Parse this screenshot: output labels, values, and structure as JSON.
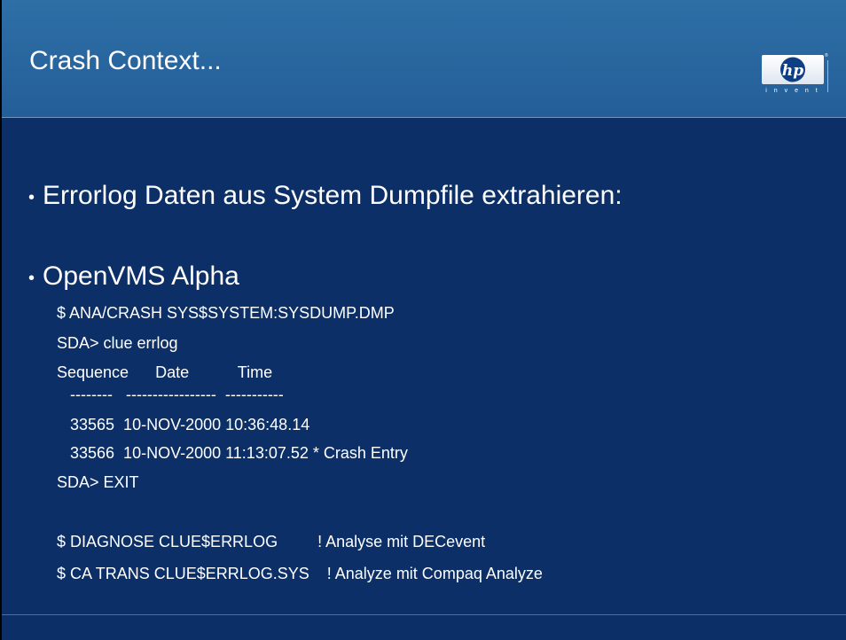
{
  "slide": {
    "title": "Crash Context...",
    "logo": {
      "mark_text": "hp",
      "tagline": "i n v e n t",
      "icon": "hp-logo-icon"
    },
    "bullets": [
      {
        "text": "Errorlog Daten aus System Dumpfile extrahieren:"
      },
      {
        "text": "OpenVMS Alpha"
      }
    ],
    "code_lines": [
      "$ ANA/CRASH SYS$SYSTEM:SYSDUMP.DMP",
      "SDA> clue errlog",
      "Sequence      Date           Time",
      "   --------   -----------------  -----------",
      "   33565  10-NOV-2000 10:36:48.14",
      "   33566  10-NOV-2000 11:13:07.52 * Crash Entry",
      "SDA> EXIT",
      "",
      "$ DIAGNOSE CLUE$ERRLOG         ! Analyse mit DECevent",
      "$ CA TRANS CLUE$ERRLOG.SYS    ! Analyze mit Compaq Analyze"
    ],
    "colors": {
      "header": "#2a67a0",
      "background": "#0b2f66",
      "text": "#ffffff"
    }
  }
}
